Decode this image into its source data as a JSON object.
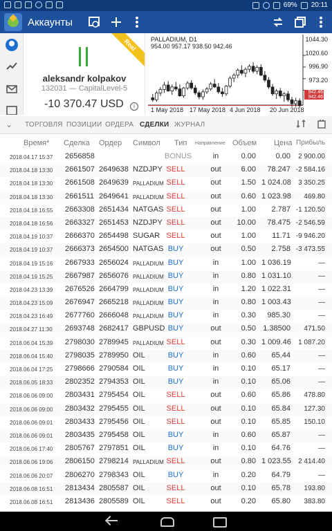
{
  "status_bar": {
    "battery": "69%",
    "time": "20:11"
  },
  "app_bar": {
    "title": "Аккаунты",
    "actions": [
      "icon-trade-icon",
      "add-icon",
      "more-icon",
      "transfer-icon",
      "copy-icon",
      "menu-icon"
    ]
  },
  "account": {
    "ribbon": "Real",
    "name": "aleksandr kolpakov",
    "sub": "132031 — CapitalLevel-5",
    "balance": "-10 370.47 USD"
  },
  "chart": {
    "title": "PALLADIUM, D1",
    "ohlc": "954.00 957.17 938.50 942.46",
    "y_ticks": [
      "1044.30",
      "1020.60",
      "996.90",
      "973.20"
    ],
    "x_ticks": [
      "1 May 2018",
      "17 May 2018",
      "4 Jun 2018",
      "20 Jun 2018"
    ],
    "price_tag_a": "942.46",
    "price_tag_b": "942.46",
    "colors": {
      "line": "#d23b3b"
    }
  },
  "chart_data": {
    "type": "candlestick",
    "title": "PALLADIUM, D1",
    "ylim": [
      946,
      1050
    ],
    "y_ticks": [
      1044.3,
      1020.6,
      996.9,
      973.2
    ],
    "x_tick_labels": [
      "1 May 2018",
      "17 May 2018",
      "4 Jun 2018",
      "20 Jun 2018"
    ],
    "current_price": 942.46,
    "candles": [
      {
        "o": 958,
        "h": 966,
        "l": 950,
        "c": 954
      },
      {
        "o": 954,
        "h": 972,
        "l": 950,
        "c": 968
      },
      {
        "o": 968,
        "h": 980,
        "l": 962,
        "c": 975
      },
      {
        "o": 975,
        "h": 990,
        "l": 968,
        "c": 984
      },
      {
        "o": 984,
        "h": 992,
        "l": 970,
        "c": 972
      },
      {
        "o": 972,
        "h": 985,
        "l": 964,
        "c": 980
      },
      {
        "o": 980,
        "h": 990,
        "l": 972,
        "c": 976
      },
      {
        "o": 976,
        "h": 985,
        "l": 960,
        "c": 962
      },
      {
        "o": 962,
        "h": 980,
        "l": 958,
        "c": 978
      },
      {
        "o": 978,
        "h": 992,
        "l": 974,
        "c": 988
      },
      {
        "o": 988,
        "h": 994,
        "l": 975,
        "c": 978
      },
      {
        "o": 978,
        "h": 984,
        "l": 964,
        "c": 968
      },
      {
        "o": 968,
        "h": 972,
        "l": 955,
        "c": 960
      },
      {
        "o": 960,
        "h": 975,
        "l": 954,
        "c": 970
      },
      {
        "o": 970,
        "h": 980,
        "l": 966,
        "c": 976
      },
      {
        "o": 976,
        "h": 990,
        "l": 972,
        "c": 986
      },
      {
        "o": 986,
        "h": 996,
        "l": 978,
        "c": 980
      },
      {
        "o": 980,
        "h": 988,
        "l": 966,
        "c": 970
      },
      {
        "o": 970,
        "h": 978,
        "l": 960,
        "c": 966
      },
      {
        "o": 966,
        "h": 984,
        "l": 962,
        "c": 982
      },
      {
        "o": 982,
        "h": 1002,
        "l": 978,
        "c": 998
      },
      {
        "o": 998,
        "h": 1008,
        "l": 990,
        "c": 1004
      },
      {
        "o": 1004,
        "h": 1018,
        "l": 998,
        "c": 1014
      },
      {
        "o": 1014,
        "h": 1024,
        "l": 1004,
        "c": 1008
      },
      {
        "o": 1008,
        "h": 1020,
        "l": 1000,
        "c": 1016
      },
      {
        "o": 1016,
        "h": 1026,
        "l": 1010,
        "c": 1022
      },
      {
        "o": 1022,
        "h": 1030,
        "l": 1008,
        "c": 1012
      },
      {
        "o": 1012,
        "h": 1024,
        "l": 1006,
        "c": 1020
      },
      {
        "o": 1020,
        "h": 1026,
        "l": 1002,
        "c": 1004
      },
      {
        "o": 1004,
        "h": 1012,
        "l": 990,
        "c": 994
      },
      {
        "o": 994,
        "h": 1000,
        "l": 976,
        "c": 980
      },
      {
        "o": 980,
        "h": 986,
        "l": 962,
        "c": 966
      },
      {
        "o": 966,
        "h": 976,
        "l": 956,
        "c": 972
      },
      {
        "o": 972,
        "h": 978,
        "l": 958,
        "c": 962
      },
      {
        "o": 962,
        "h": 970,
        "l": 950,
        "c": 966
      },
      {
        "o": 966,
        "h": 972,
        "l": 950,
        "c": 954
      },
      {
        "o": 954,
        "h": 960,
        "l": 940,
        "c": 946
      },
      {
        "o": 946,
        "h": 958,
        "l": 940,
        "c": 952
      },
      {
        "o": 952,
        "h": 957,
        "l": 938,
        "c": 942
      }
    ]
  },
  "tabs": [
    "ТОРГОВЛЯ",
    "ПОЗИЦИИ",
    "ОРДЕРА",
    "СДЕЛКИ",
    "ЖУРНАЛ"
  ],
  "active_tab": "СДЕЛКИ",
  "table": {
    "headers": {
      "time": "Время*",
      "deal": "Сделка",
      "order": "Ордер",
      "symbol": "Символ",
      "type": "Тип",
      "direction": "Направление",
      "volume": "Объем",
      "price": "Цена",
      "profit": "Прибыль"
    },
    "rows": [
      {
        "time": "2018.04.17 15:37",
        "deal": "2656858",
        "order": "",
        "symbol": "",
        "type": "BONUS",
        "dir": "in",
        "vol": "0.00",
        "price": "0.00",
        "profit": "2 900.00"
      },
      {
        "time": "2018.04.18 13:30",
        "deal": "2661507",
        "order": "2649638",
        "symbol": "NZDJPY",
        "type": "SELL",
        "dir": "out",
        "vol": "6.00",
        "price": "78.247",
        "profit": "-2 584.16"
      },
      {
        "time": "2018.04.18 13:30",
        "deal": "2661508",
        "order": "2649639",
        "symbol": "PALLADIUM",
        "type": "SELL",
        "dir": "out",
        "vol": "1.50",
        "price": "1 024.08",
        "profit": "3 350.25"
      },
      {
        "time": "2018.04.18 13:30",
        "deal": "2661511",
        "order": "2649641",
        "symbol": "PALLADIUM",
        "type": "SELL",
        "dir": "out",
        "vol": "0.60",
        "price": "1 023.98",
        "profit": "469.80"
      },
      {
        "time": "2018.04.18 16:55",
        "deal": "2663308",
        "order": "2651434",
        "symbol": "NATGAS",
        "type": "SELL",
        "dir": "out",
        "vol": "1.00",
        "price": "2.787",
        "profit": "-1 120.50"
      },
      {
        "time": "2018.04.18 16:56",
        "deal": "2663327",
        "order": "2651453",
        "symbol": "NZDJPY",
        "type": "SELL",
        "dir": "out",
        "vol": "10.00",
        "price": "78.475",
        "profit": "-2 546.59"
      },
      {
        "time": "2018.04.19 10:37",
        "deal": "2666370",
        "order": "2654498",
        "symbol": "SUGAR",
        "type": "SELL",
        "dir": "out",
        "vol": "1.00",
        "price": "11.71",
        "profit": "-9 946.20"
      },
      {
        "time": "2018.04.19 10:37",
        "deal": "2666373",
        "order": "2654500",
        "symbol": "NATGAS",
        "type": "BUY",
        "dir": "out",
        "vol": "0.50",
        "price": "2.758",
        "profit": "-3 473.55"
      },
      {
        "time": "2018.04.19 15:16",
        "deal": "2667933",
        "order": "2656024",
        "symbol": "PALLADIUM",
        "type": "BUY",
        "dir": "in",
        "vol": "1.00",
        "price": "1 036.19",
        "profit": "—"
      },
      {
        "time": "2018.04.19 15:25",
        "deal": "2667987",
        "order": "2656076",
        "symbol": "PALLADIUM",
        "type": "BUY",
        "dir": "in",
        "vol": "0.80",
        "price": "1 031.10",
        "profit": "—"
      },
      {
        "time": "2018.04.23 13:39",
        "deal": "2676526",
        "order": "2664799",
        "symbol": "PALLADIUM",
        "type": "BUY",
        "dir": "in",
        "vol": "1.20",
        "price": "1 022.31",
        "profit": "—"
      },
      {
        "time": "2018.04.23 15:09",
        "deal": "2676947",
        "order": "2665218",
        "symbol": "PALLADIUM",
        "type": "BUY",
        "dir": "in",
        "vol": "0.80",
        "price": "1 003.43",
        "profit": "—"
      },
      {
        "time": "2018.04.23 16:49",
        "deal": "2677760",
        "order": "2666048",
        "symbol": "PALLADIUM",
        "type": "BUY",
        "dir": "in",
        "vol": "0.30",
        "price": "985.30",
        "profit": "—"
      },
      {
        "time": "2018.04.27 11:30",
        "deal": "2693748",
        "order": "2682417",
        "symbol": "GBPUSD",
        "type": "BUY",
        "dir": "out",
        "vol": "0.50",
        "price": "1.38500",
        "profit": "471.50"
      },
      {
        "time": "2018.06.04 15:39",
        "deal": "2798030",
        "order": "2789945",
        "symbol": "PALLADIUM",
        "type": "SELL",
        "dir": "out",
        "vol": "0.30",
        "price": "1 009.46",
        "profit": "1 087.20"
      },
      {
        "time": "2018.06.04 15:40",
        "deal": "2798035",
        "order": "2789950",
        "symbol": "OIL",
        "type": "BUY",
        "dir": "in",
        "vol": "0.60",
        "price": "65.44",
        "profit": "—"
      },
      {
        "time": "2018.06.04 17:25",
        "deal": "2798666",
        "order": "2790584",
        "symbol": "OIL",
        "type": "BUY",
        "dir": "in",
        "vol": "0.10",
        "price": "65.17",
        "profit": "—"
      },
      {
        "time": "2018.06.05 18:33",
        "deal": "2802352",
        "order": "2794353",
        "symbol": "OIL",
        "type": "BUY",
        "dir": "in",
        "vol": "0.10",
        "price": "65.06",
        "profit": "—"
      },
      {
        "time": "2018.06.06 09:00",
        "deal": "2803431",
        "order": "2795454",
        "symbol": "OIL",
        "type": "SELL",
        "dir": "out",
        "vol": "0.60",
        "price": "65.86",
        "profit": "478.80"
      },
      {
        "time": "2018.06.06 09:00",
        "deal": "2803432",
        "order": "2795455",
        "symbol": "OIL",
        "type": "SELL",
        "dir": "out",
        "vol": "0.10",
        "price": "65.84",
        "profit": "127.30"
      },
      {
        "time": "2018.06.06 09:01",
        "deal": "2803433",
        "order": "2795456",
        "symbol": "OIL",
        "type": "SELL",
        "dir": "out",
        "vol": "0.10",
        "price": "65.85",
        "profit": "150.10"
      },
      {
        "time": "2018.06.06 09:01",
        "deal": "2803435",
        "order": "2795458",
        "symbol": "OIL",
        "type": "BUY",
        "dir": "in",
        "vol": "0.60",
        "price": "65.87",
        "profit": "—"
      },
      {
        "time": "2018.06.06 17:40",
        "deal": "2805767",
        "order": "2797851",
        "symbol": "OIL",
        "type": "BUY",
        "dir": "in",
        "vol": "0.10",
        "price": "64.76",
        "profit": "—"
      },
      {
        "time": "2018.06.06 19:06",
        "deal": "2806150",
        "order": "2798214",
        "symbol": "PALLADIUM",
        "type": "SELL",
        "dir": "out",
        "vol": "0.80",
        "price": "1 023.55",
        "profit": "2 414.40"
      },
      {
        "time": "2018.06.06 20:07",
        "deal": "2806270",
        "order": "2798343",
        "symbol": "OIL",
        "type": "BUY",
        "dir": "in",
        "vol": "0.20",
        "price": "64.79",
        "profit": "—"
      },
      {
        "time": "2018.06.08 16:51",
        "deal": "2813434",
        "order": "2805587",
        "symbol": "OIL",
        "type": "SELL",
        "dir": "out",
        "vol": "0.10",
        "price": "65.78",
        "profit": "193.80"
      },
      {
        "time": "2018.06.08 16:51",
        "deal": "2813436",
        "order": "2805589",
        "symbol": "OIL",
        "type": "SELL",
        "dir": "out",
        "vol": "0.20",
        "price": "65.80",
        "profit": "383.80"
      }
    ]
  }
}
